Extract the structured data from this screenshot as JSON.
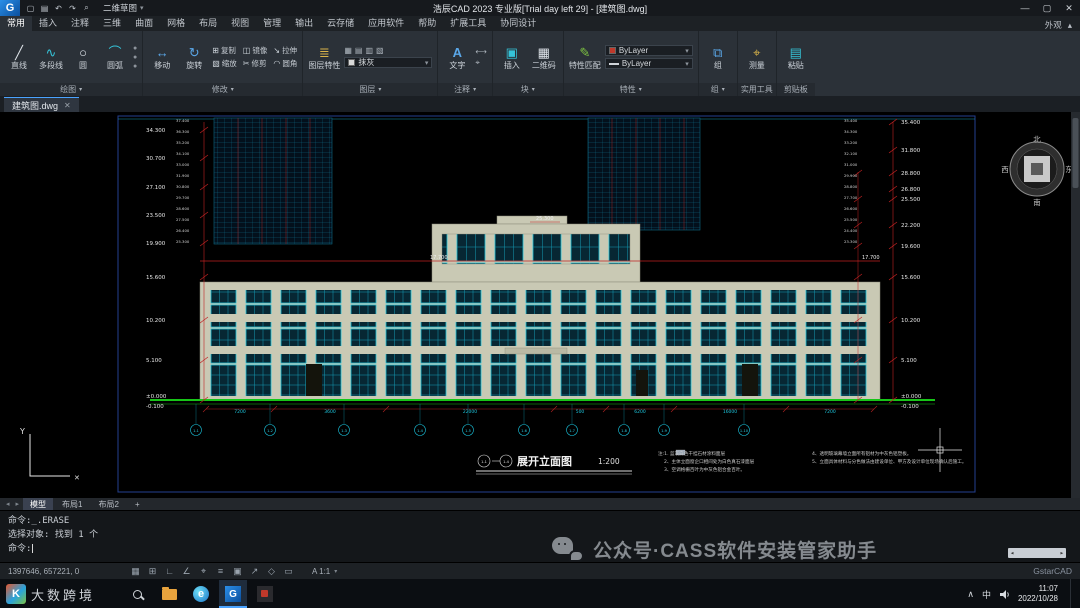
{
  "titlebar": {
    "app_title": "浩辰CAD 2023 专业版[Trial day left 29] - [建筑图.dwg]",
    "workspace": "二维草图",
    "logo_letter": "G",
    "quick_icons": [
      "▢",
      "▤",
      "↶",
      "↷",
      "⌕"
    ],
    "window_controls": {
      "minimize": "—",
      "restore": "▢",
      "close": "✕"
    }
  },
  "tabs": {
    "items": [
      "常用",
      "插入",
      "注释",
      "三维",
      "曲面",
      "网格",
      "布局",
      "视图",
      "管理",
      "输出",
      "云存储",
      "应用软件",
      "帮助",
      "扩展工具",
      "协同设计"
    ],
    "active": "常用",
    "right_label": "外观",
    "collapse_icon": "▴"
  },
  "ribbon": {
    "draw": {
      "caption": "绘图",
      "tools": [
        "直线",
        "多段线",
        "圆",
        "圆弧"
      ],
      "icons": [
        "╱",
        "∿",
        "○",
        "⌒"
      ]
    },
    "modify": {
      "caption": "修改",
      "big": [
        "移动",
        "旋转"
      ],
      "big_icons": [
        "↔",
        "↻"
      ],
      "small": [
        "复制",
        "镜像",
        "拉伸",
        "缩放",
        "修剪",
        "圆角"
      ],
      "small_icons": [
        "⊞",
        "◫",
        "↘",
        "▧",
        "✂",
        "◠"
      ]
    },
    "layer": {
      "caption": "图层",
      "tool": "图层特性",
      "tool_icon": "≣",
      "current_layer": "抹灰",
      "mini_icons": [
        "▦",
        "▤",
        "▥",
        "▧"
      ]
    },
    "annotate": {
      "caption": "注释",
      "tool": "文字",
      "tool_icon": "A",
      "mini_icons": [
        "⟷",
        "⌖"
      ]
    },
    "block": {
      "caption": "块",
      "tools": [
        "插入",
        "二维码"
      ],
      "icons": [
        "▣",
        "▦"
      ]
    },
    "properties": {
      "caption": "特性",
      "tool": "特性匹配",
      "tool_icon": "✎",
      "selects": [
        "ByLayer",
        "ByLayer"
      ]
    },
    "group": {
      "caption": "组",
      "tool": "组",
      "tool_icon": "⧉"
    },
    "utilities": {
      "caption": "实用工具",
      "tool": "测量",
      "tool_icon": "⌖"
    },
    "clipboard": {
      "caption": "剪贴板",
      "tool": "粘贴",
      "tool_icon": "▤"
    }
  },
  "document": {
    "tab_title": "建筑图.dwg",
    "close": "✕"
  },
  "drawing": {
    "left_elevations": [
      "34.300",
      "30.700",
      "27.100",
      "23.500",
      "19.900",
      "15.600",
      "10.200",
      "5.100",
      "±0.000",
      "-0.100"
    ],
    "right_elevations": [
      "35.400",
      "31.800",
      "28.800",
      "26.800",
      "25.500",
      "22.200",
      "19.600",
      "15.600",
      "10.200",
      "5.100",
      "±0.000",
      "-0.100"
    ],
    "left_floor_table": [
      "37.400",
      "36.300",
      "35.200",
      "34.100",
      "33.000",
      "31.900",
      "30.800",
      "29.700",
      "28.600",
      "27.500",
      "26.400",
      "25.300"
    ],
    "right_floor_table": [
      "35.400",
      "34.300",
      "33.200",
      "32.100",
      "31.000",
      "29.900",
      "28.800",
      "27.700",
      "26.600",
      "25.500",
      "24.400",
      "23.300"
    ],
    "mid_elevation": "17.700",
    "top_elevation": "25.300",
    "bottom_dims": [
      "7200",
      "3600",
      "22000",
      "500",
      "6200",
      "16000",
      "7200"
    ],
    "axis_bubbles": [
      "1-1",
      "1-2",
      "1-3",
      "1-4",
      "1-5",
      "1-6",
      "1-7",
      "1-8",
      "1-9",
      "1-10"
    ],
    "plan_title": {
      "axis_start": "1-1",
      "axis_end": "1-4",
      "text": "展开立面图",
      "scale": "1:200"
    },
    "notes": [
      "注:1.  蓝灰白色干挂石材涂料面层",
      "2、主体立面窗企口相间处为白色真石漆面层",
      "3、空调格栅百叶为中灰色铝合金百叶。",
      "4、透明玻璃幕墙立面所有铝材为中灰色铝塑板。",
      "5、立面具体材料与分色做法由建设单位、甲方及设计单位现场确认后施工。"
    ],
    "compass": {
      "n": "北",
      "s": "南",
      "w": "西",
      "e": "东"
    },
    "ucs": {
      "y_label": "Y",
      "x_marker": "✕"
    }
  },
  "layout_tabs": {
    "items": [
      "模型",
      "布局1",
      "布局2"
    ],
    "add_label": "+"
  },
  "command": {
    "lines": [
      "命令:_.ERASE",
      "选择对象: 找到 1 个",
      "命令:"
    ]
  },
  "status": {
    "coords": "1397646, 657221, 0",
    "icons": [
      "▦",
      "⊞",
      "∟",
      "∠",
      "⌖",
      "≡",
      "▣",
      "↗",
      "◇",
      "▭"
    ],
    "scale_label": "A 1:1",
    "brand": "GstarCAD"
  },
  "watermark": {
    "text": "公众号·CASS软件安装管家助手"
  },
  "taskbar": {
    "watermark_text": "大数跨境",
    "watermark_logo": "K",
    "collapse": "∧",
    "lang_indicator": "中",
    "time": "11:07",
    "date": "2022/10/28"
  }
}
